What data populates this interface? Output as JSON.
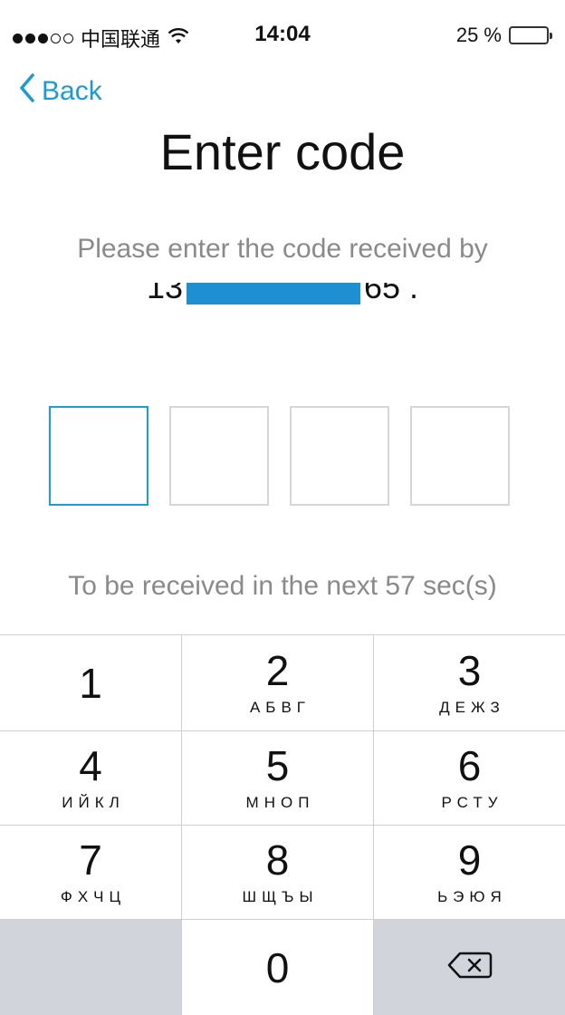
{
  "status_bar": {
    "carrier": "中国联通",
    "time": "14:04",
    "battery": "25 %",
    "battery_level": 0.25,
    "battery_color": "#f5c518"
  },
  "nav": {
    "back_label": "Back",
    "back_icon": "chevron-left-icon"
  },
  "title": "Enter code",
  "subtitle": "Please enter the code received by",
  "phone": {
    "prefix": "13",
    "suffix": "65 ."
  },
  "code_boxes": [
    "",
    "",
    "",
    ""
  ],
  "timer": "To be received in the next 57 sec(s)",
  "keypad": {
    "keys": [
      {
        "num": "1",
        "letters": ""
      },
      {
        "num": "2",
        "letters": "АБВГ"
      },
      {
        "num": "3",
        "letters": "ДЕЖЗ"
      },
      {
        "num": "4",
        "letters": "ИЙКЛ"
      },
      {
        "num": "5",
        "letters": "МНОП"
      },
      {
        "num": "6",
        "letters": "РСТУ"
      },
      {
        "num": "7",
        "letters": "ФХЧЦ"
      },
      {
        "num": "8",
        "letters": "ШЩЪЫ"
      },
      {
        "num": "9",
        "letters": "ЬЭЮЯ"
      },
      {
        "num": "0",
        "letters": ""
      }
    ],
    "delete_icon": "backspace-icon"
  },
  "colors": {
    "accent": "#1a9bd7",
    "active_box": "#1aa0d0",
    "gray_text": "#8a8a8a"
  }
}
